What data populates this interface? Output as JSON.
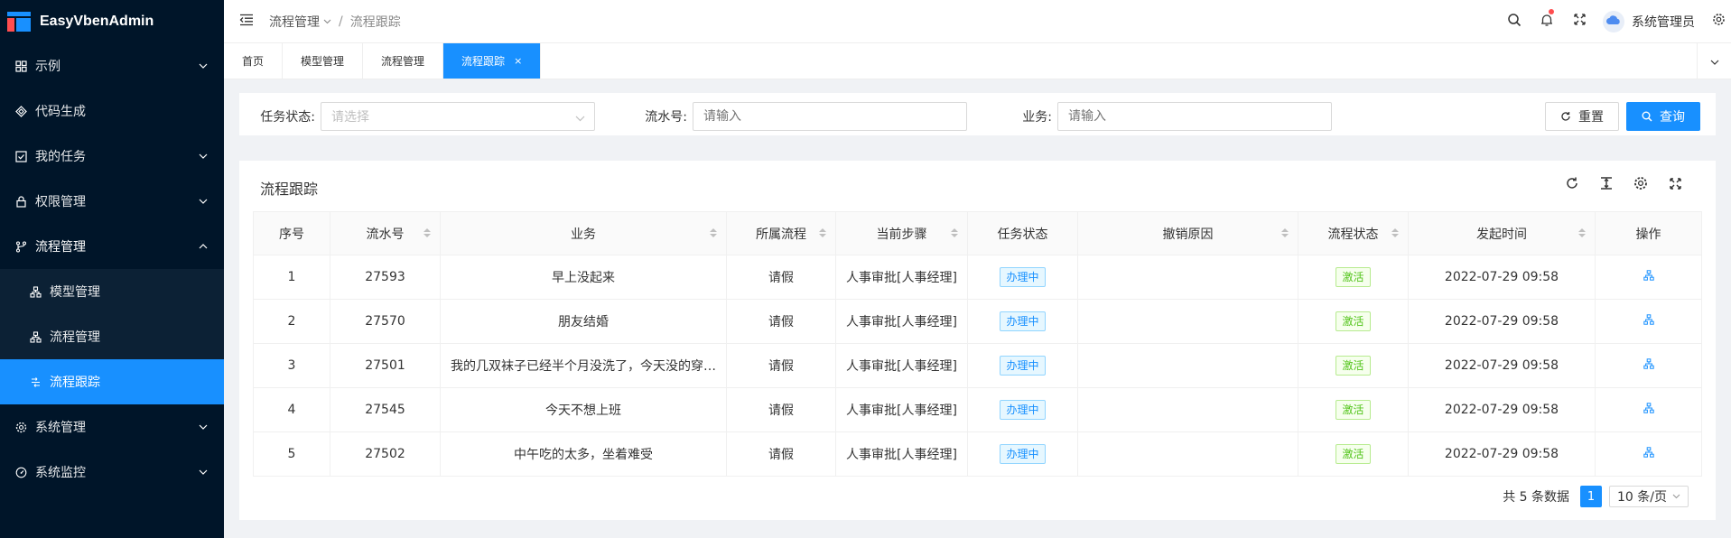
{
  "app": {
    "name": "EasyVbenAdmin"
  },
  "sidebar": {
    "items": [
      {
        "label": "示例",
        "icon": "grid-icon",
        "expandable": true
      },
      {
        "label": "代码生成",
        "icon": "code-icon",
        "expandable": false
      },
      {
        "label": "我的任务",
        "icon": "checkbox-icon",
        "expandable": true
      },
      {
        "label": "权限管理",
        "icon": "lock-icon",
        "expandable": true
      },
      {
        "label": "流程管理",
        "icon": "branch-icon",
        "expandable": true,
        "open": true
      },
      {
        "label": "系统管理",
        "icon": "gear-icon",
        "expandable": true
      },
      {
        "label": "系统监控",
        "icon": "dashboard-icon",
        "expandable": true
      }
    ],
    "subitems": [
      {
        "label": "模型管理",
        "icon": "sitemap-icon"
      },
      {
        "label": "流程管理",
        "icon": "sitemap-icon"
      },
      {
        "label": "流程跟踪",
        "icon": "flow-track-icon",
        "active": true
      }
    ]
  },
  "header": {
    "breadcrumb": {
      "parent": "流程管理",
      "separator": "/",
      "current": "流程跟踪"
    },
    "username": "系统管理员"
  },
  "tabs": [
    {
      "label": "首页"
    },
    {
      "label": "模型管理"
    },
    {
      "label": "流程管理"
    },
    {
      "label": "流程跟踪",
      "active": true,
      "close": "×"
    }
  ],
  "search": {
    "task_status_label": "任务状态:",
    "task_status_placeholder": "请选择",
    "serial_label": "流水号:",
    "serial_placeholder": "请输入",
    "business_label": "业务:",
    "business_placeholder": "请输入",
    "reset_label": "重置",
    "query_label": "查询"
  },
  "table": {
    "title": "流程跟踪",
    "columns": [
      "序号",
      "流水号",
      "业务",
      "所属流程",
      "当前步骤",
      "任务状态",
      "撤销原因",
      "流程状态",
      "发起时间",
      "操作"
    ],
    "rows": [
      {
        "index": "1",
        "serial": "27593",
        "business": "早上没起来",
        "process": "请假",
        "step": "人事审批[人事经理]",
        "task_status": "办理中",
        "reason": "",
        "flow_status": "激活",
        "time": "2022-07-29 09:58"
      },
      {
        "index": "2",
        "serial": "27570",
        "business": "朋友结婚",
        "process": "请假",
        "step": "人事审批[人事经理]",
        "task_status": "办理中",
        "reason": "",
        "flow_status": "激活",
        "time": "2022-07-29 09:58"
      },
      {
        "index": "3",
        "serial": "27501",
        "business": "我的几双袜子已经半个月没洗了，今天没的穿…",
        "process": "请假",
        "step": "人事审批[人事经理]",
        "task_status": "办理中",
        "reason": "",
        "flow_status": "激活",
        "time": "2022-07-29 09:58"
      },
      {
        "index": "4",
        "serial": "27545",
        "business": "今天不想上班",
        "process": "请假",
        "step": "人事审批[人事经理]",
        "task_status": "办理中",
        "reason": "",
        "flow_status": "激活",
        "time": "2022-07-29 09:58"
      },
      {
        "index": "5",
        "serial": "27502",
        "business": "中午吃的太多，坐着难受",
        "process": "请假",
        "step": "人事审批[人事经理]",
        "task_status": "办理中",
        "reason": "",
        "flow_status": "激活",
        "time": "2022-07-29 09:58"
      }
    ]
  },
  "pagination": {
    "total_text": "共 5 条数据",
    "current_page": "1",
    "page_size": "10 条/页"
  },
  "colors": {
    "sidebar_bg": "#001529",
    "primary": "#1890ff",
    "tag_blue": "#1890ff",
    "tag_green": "#52c41a"
  }
}
